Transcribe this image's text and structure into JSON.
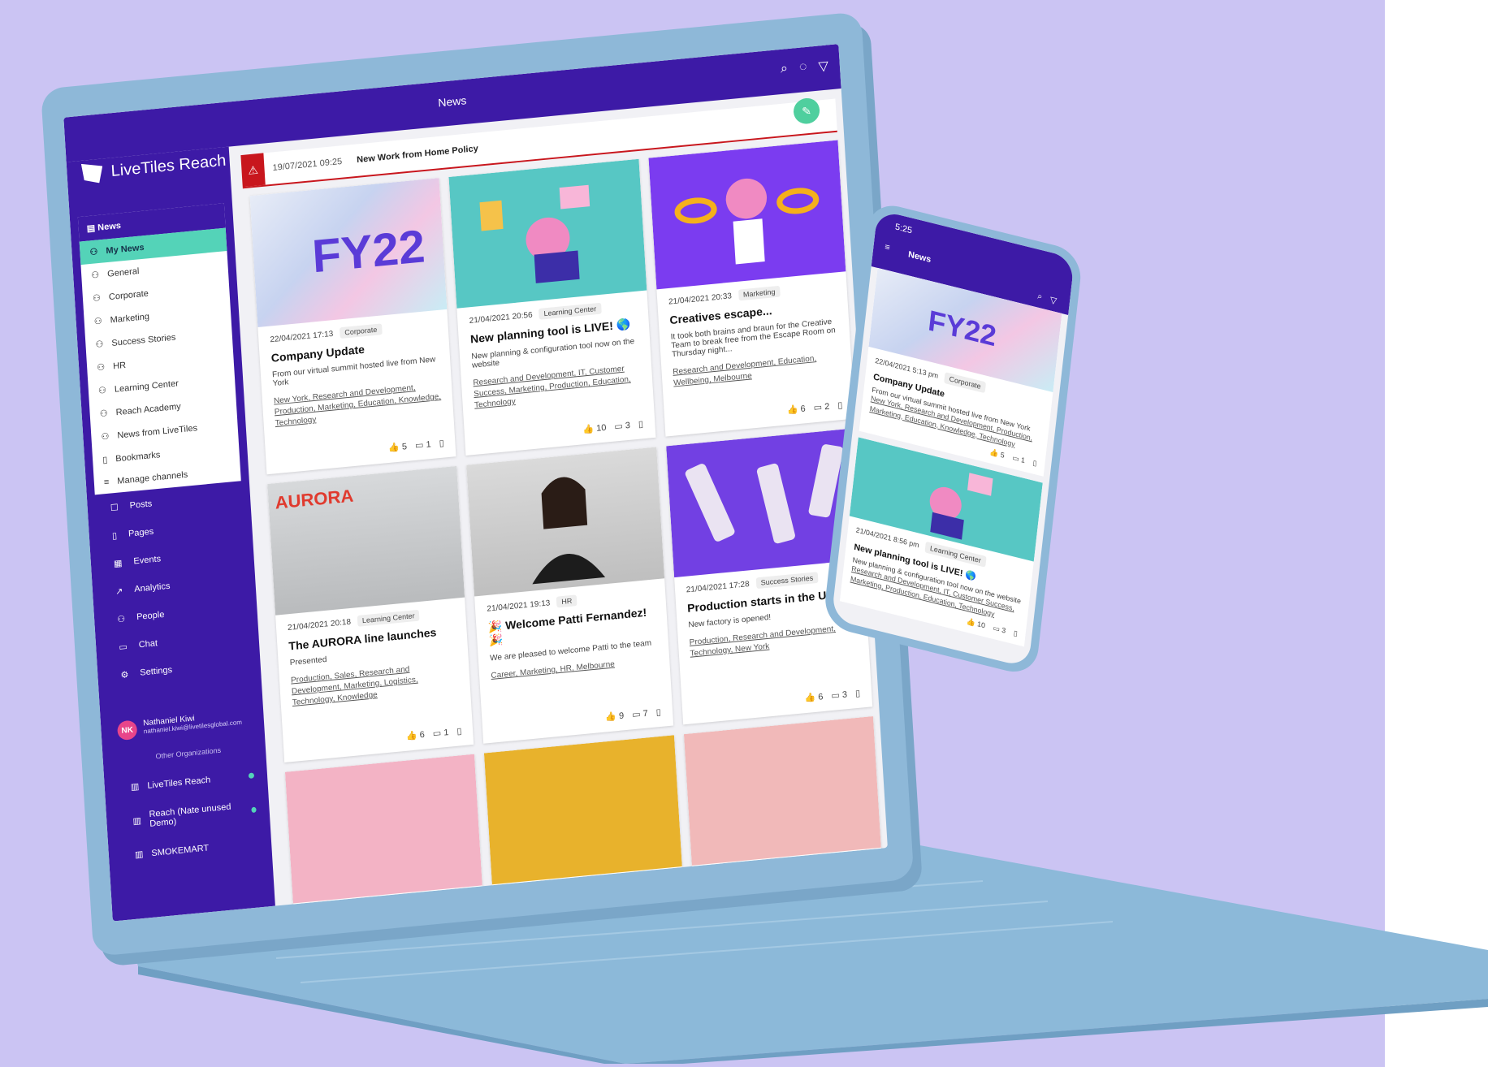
{
  "colors": {
    "background": "#cbc4f3",
    "brand": "#3d1aa6",
    "accent": "#54d3b8",
    "alert": "#c8161d",
    "device": "#8eb8d8"
  },
  "app": {
    "name": "LiveTiles Reach",
    "page_title": "News"
  },
  "toolbar": {
    "icons": [
      "search-icon",
      "bulb-icon",
      "filter-icon"
    ]
  },
  "channels": {
    "header": "News",
    "items": [
      "My News",
      "General",
      "Corporate",
      "Marketing",
      "Success Stories",
      "HR",
      "Learning Center",
      "Reach Academy",
      "News from LiveTiles",
      "Bookmarks",
      "Manage channels"
    ]
  },
  "nav": {
    "items": [
      "Posts",
      "Pages",
      "Events",
      "Analytics",
      "People",
      "Chat",
      "Settings"
    ]
  },
  "user": {
    "initials": "NK",
    "name": "Nathaniel Kiwi",
    "email": "nathaniel.kiwi@livetilesglobal.com"
  },
  "other_orgs": {
    "label": "Other Organizations",
    "items": [
      "LiveTiles Reach",
      "Reach (Nate unused Demo)",
      "SMOKEMART"
    ]
  },
  "alert": {
    "date": "19/07/2021 09:25",
    "text": "New Work from Home Policy"
  },
  "cards": [
    {
      "image_text": "FY22",
      "date": "22/04/2021 17:13",
      "channel": "Corporate",
      "title": "Company Update",
      "excerpt": "From our virtual summit hosted live from New York",
      "tags": "New York, Research and Development, Production, Marketing, Education, Knowledge, Technology",
      "likes": "5",
      "comments": "1"
    },
    {
      "image_text": "",
      "date": "21/04/2021 20:56",
      "channel": "Learning Center",
      "title": "New planning tool is LIVE! 🌎",
      "excerpt": "New planning & configuration tool now on the website",
      "tags": "Research and Development, IT, Customer Success, Marketing, Production, Education, Technology",
      "likes": "10",
      "comments": "3"
    },
    {
      "image_text": "",
      "date": "21/04/2021 20:33",
      "channel": "Marketing",
      "title": "Creatives escape...",
      "excerpt": "It took both brains and braun for the Creative Team to break free from the Escape Room on Thursday night...",
      "tags": "Research and Development, Education, Wellbeing, Melbourne",
      "likes": "6",
      "comments": "2"
    },
    {
      "image_text": "AURORA",
      "date": "21/04/2021 20:18",
      "channel": "Learning Center",
      "title": "The AURORA line launches",
      "excerpt": "Presented",
      "tags": "Production, Sales, Research and Development, Marketing, Logistics, Technology, Knowledge",
      "likes": "6",
      "comments": "1"
    },
    {
      "image_text": "",
      "date": "21/04/2021 19:13",
      "channel": "HR",
      "title": "🎉 Welcome Patti Fernandez! 🎉",
      "excerpt": "We are pleased to welcome Patti to the team",
      "tags": "Career, Marketing, HR, Melbourne",
      "likes": "9",
      "comments": "7"
    },
    {
      "image_text": "",
      "date": "21/04/2021 17:28",
      "channel": "Success Stories",
      "title": "Production starts in the US",
      "excerpt": "New factory is opened!",
      "tags": "Production, Research and Development, Technology, New York",
      "likes": "6",
      "comments": "3"
    }
  ],
  "phone": {
    "time": "5:25",
    "title": "News",
    "cards": [
      {
        "image_text": "FY22",
        "date": "22/04/2021 5:13 pm",
        "channel": "Corporate",
        "title": "Company Update",
        "excerpt": "From our virtual summit hosted live from New York",
        "tags": "New York, Research and Development, Production, Marketing, Education, Knowledge, Technology",
        "likes": "5",
        "comments": "1"
      },
      {
        "image_text": "",
        "date": "21/04/2021 8:56 pm",
        "channel": "Learning Center",
        "title": "New planning tool is LIVE! 🌎",
        "excerpt": "New planning & configuration tool now on the website",
        "tags": "Research and Development, IT, Customer Success, Marketing, Production, Education, Technology",
        "likes": "10",
        "comments": "3"
      }
    ]
  }
}
